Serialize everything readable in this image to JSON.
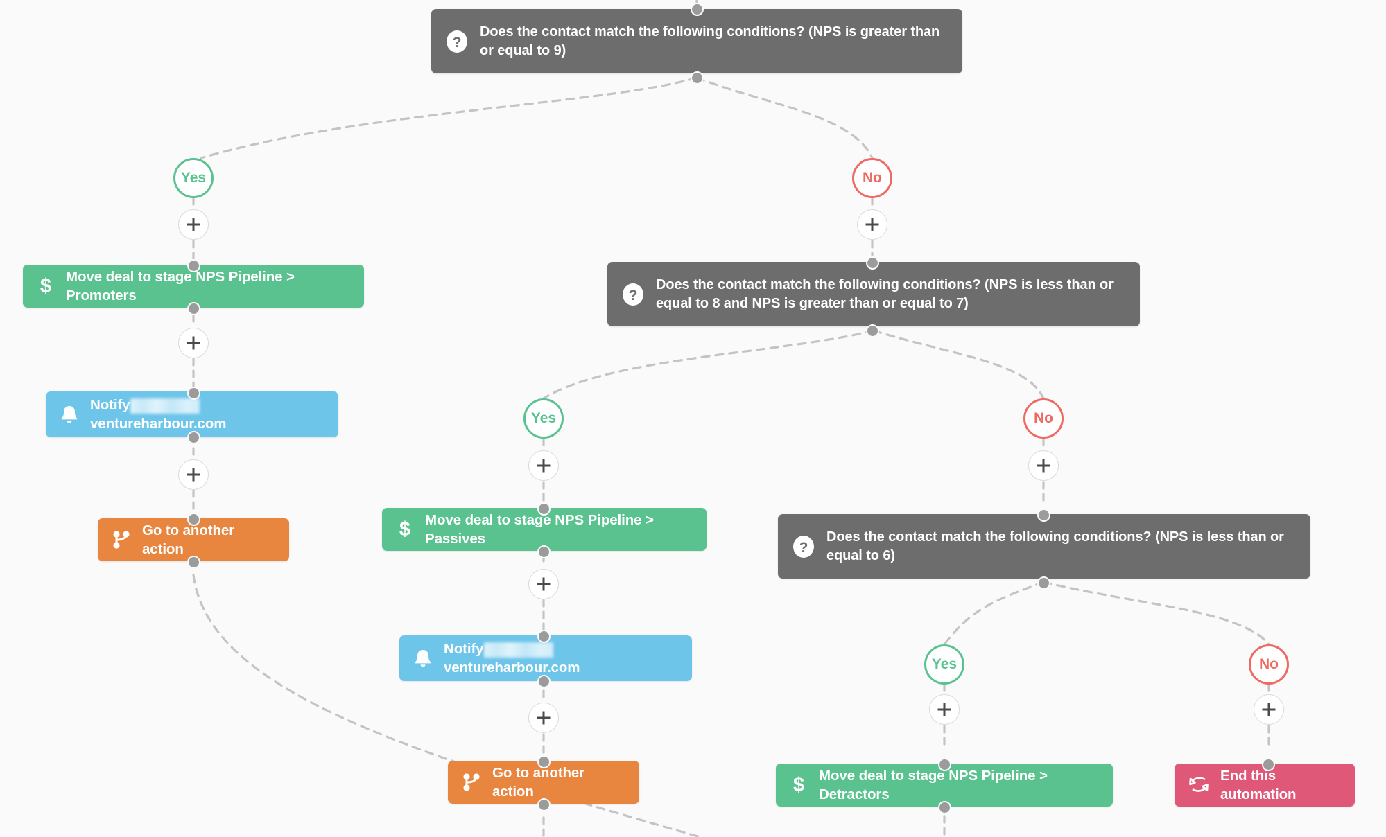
{
  "canvas": {
    "background_color": "#fafafa",
    "title": "NPS automation workflow"
  },
  "palette": {
    "condition": "#6d6d6d",
    "move_deal": "#5ac28f",
    "notify": "#6ec5ea",
    "goto": "#e8853f",
    "end": "#e05878",
    "yes": "#5ac28f",
    "no": "#ef6a63",
    "wire": "#c4c4c4",
    "port": "#9b9b9b"
  },
  "labels": {
    "yes": "Yes",
    "no": "No",
    "add_step": "+"
  },
  "nodes": {
    "condition_promoters": {
      "icon": "question-mark-icon",
      "text": "Does the contact match the following conditions? (NPS is greater than or equal to 9)"
    },
    "move_promoters": {
      "icon": "dollar-sign-icon",
      "text": "Move deal to stage NPS Pipeline > Promoters"
    },
    "notify_promoters": {
      "icon": "bell-icon",
      "text_before": "Notify",
      "text_redacted": "[redacted]",
      "text_after": "ventureharbour.com"
    },
    "goto_promoters": {
      "icon": "branch-icon",
      "text": "Go to another action"
    },
    "condition_passives": {
      "icon": "question-mark-icon",
      "text": "Does the contact match the following conditions? (NPS is less than or equal to 8 and NPS is greater than or equal to 7)"
    },
    "move_passives": {
      "icon": "dollar-sign-icon",
      "text": "Move deal to stage NPS Pipeline > Passives"
    },
    "notify_passives": {
      "icon": "bell-icon",
      "text_before": "Notify",
      "text_redacted": "[redacted]",
      "text_after": "ventureharbour.com"
    },
    "goto_passives": {
      "icon": "branch-icon",
      "text": "Go to another action"
    },
    "condition_detractors": {
      "icon": "question-mark-icon",
      "text": "Does the contact match the following conditions? (NPS is less than or equal to 6)"
    },
    "move_detractors": {
      "icon": "dollar-sign-icon",
      "text": "Move deal to stage NPS Pipeline > Detractors"
    },
    "end_automation": {
      "icon": "end-automation-icon",
      "text": "End this automation"
    }
  }
}
